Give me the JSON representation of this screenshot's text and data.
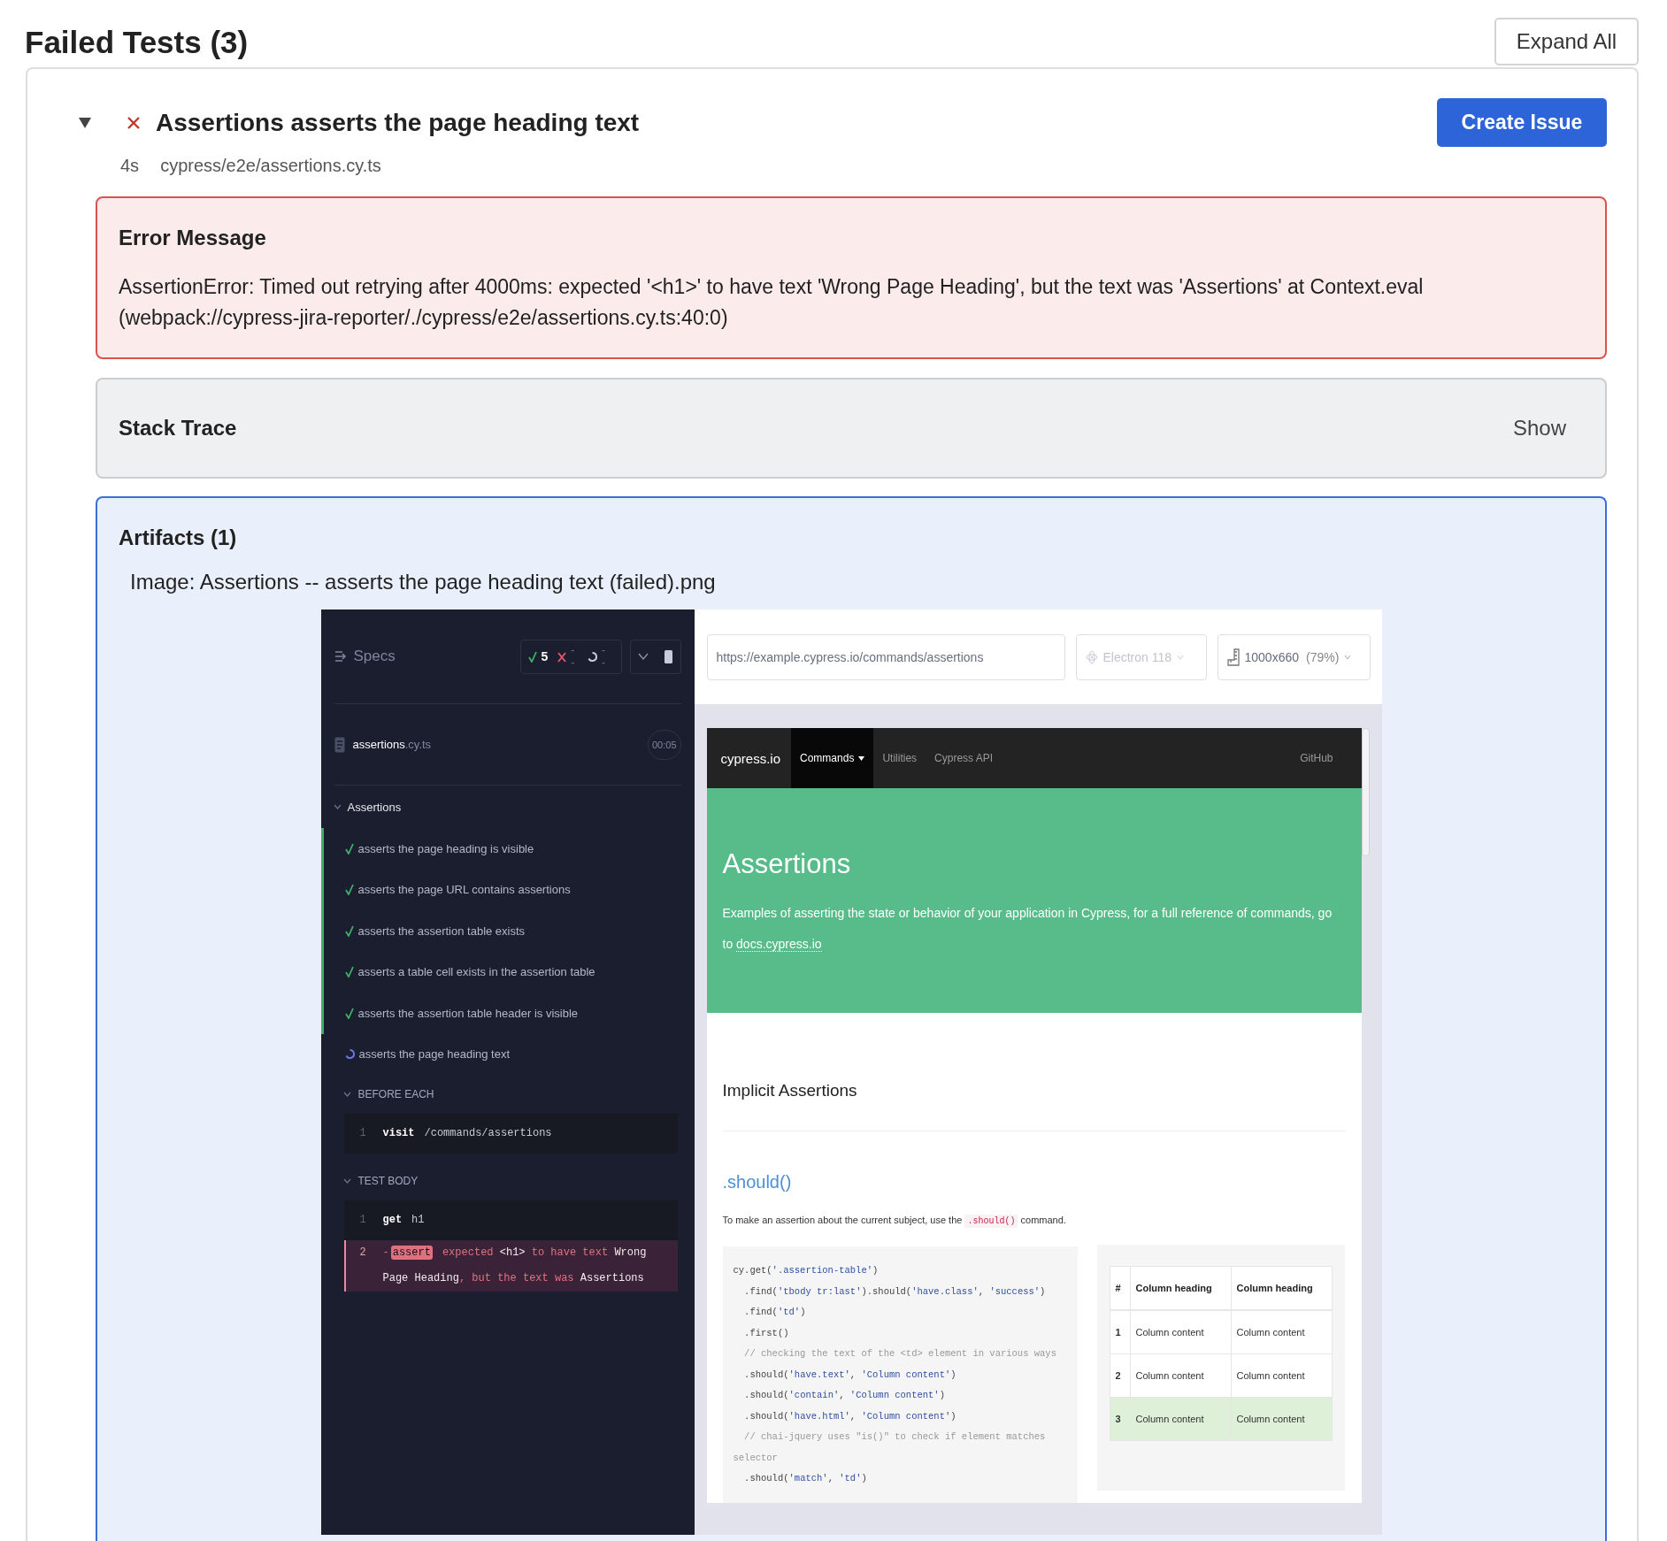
{
  "title": "Failed Tests (3)",
  "expand_all": "Expand All",
  "tests": [
    {
      "title": "Assertions asserts the page heading text",
      "kind": "failed",
      "expanded": true,
      "duration": "4s",
      "file": "cypress/e2e/assertions.cy.ts",
      "create_issue": "Create Issue",
      "error": {
        "title": "Error Message",
        "message": "AssertionError: Timed out retrying after 4000ms: expected '<h1>' to have text 'Wrong Page Heading', but the text was 'Assertions' at Context.eval (webpack://cypress-jira-reporter/./cypress/e2e/assertions.cy.ts:40:0)"
      },
      "stack_trace": {
        "title": "Stack Trace",
        "toggle": "Show"
      },
      "artifacts": {
        "title": "Artifacts (1)",
        "items": [
          {
            "kind": "image",
            "caption": "Image: Assertions -- asserts the page heading text (failed).png",
            "screenshot": {
              "runner": {
                "title": "Specs",
                "stats": [
                  {
                    "kind": "passed",
                    "count": "5"
                  },
                  {
                    "kind": "failed",
                    "count": "--"
                  },
                  {
                    "kind": "pending",
                    "count": "--"
                  }
                ],
                "spec": {
                  "name": "assertions",
                  "ext": ".cy.ts",
                  "time": "00:05"
                },
                "suite": {
                  "title": "Assertions",
                  "expanded": true,
                  "tests": [
                    {
                      "title": "asserts the page heading is visible",
                      "kind": "passed"
                    },
                    {
                      "title": "asserts the page URL contains assertions",
                      "kind": "passed"
                    },
                    {
                      "title": "asserts the assertion table exists",
                      "kind": "passed"
                    },
                    {
                      "title": "asserts a table cell exists in the assertion table",
                      "kind": "passed"
                    },
                    {
                      "title": "asserts the assertion table header is visible",
                      "kind": "passed"
                    },
                    {
                      "title": "asserts the page heading text",
                      "kind": "running"
                    }
                  ]
                },
                "sections": [
                  {
                    "title": "BEFORE EACH",
                    "expanded": true,
                    "commands": [
                      {
                        "number": "1",
                        "name": "visit",
                        "message": "/commands/assertions",
                        "kind": "passed"
                      }
                    ]
                  },
                  {
                    "title": "TEST BODY",
                    "expanded": true,
                    "commands": [
                      {
                        "number": "1",
                        "name": "get",
                        "message": "h1",
                        "kind": "passed"
                      },
                      {
                        "number": "2",
                        "prefix": "-",
                        "name": "assert",
                        "message": "expected **<h1>** to have text **Wrong Page Heading**, but the text was **Assertions**",
                        "kind": "failed"
                      }
                    ]
                  }
                ]
              },
              "browser": {
                "url": "https://example.cypress.io/commands/assertions",
                "engine": "Electron 118",
                "viewport": "1000x660",
                "scale": "(79%)"
              },
              "app": {
                "brand": "cypress.io",
                "nav": [
                  {
                    "label": "Commands",
                    "selected": true,
                    "dropdown": true
                  },
                  {
                    "label": "Utilities",
                    "selected": false,
                    "dropdown": false
                  },
                  {
                    "label": "Cypress API",
                    "selected": false,
                    "dropdown": false
                  }
                ],
                "nav_right": "GitHub",
                "banner": {
                  "title": "Assertions",
                  "text": "Examples of asserting the state or behavior of your application in Cypress, for a full reference of commands, go to",
                  "link": "docs.cypress.io"
                },
                "section_title": "Implicit Assertions",
                "subsection_title": ".should()",
                "intro": {
                  "before": "To make an assertion about the current subject, use the",
                  "code": ".should()",
                  "after": "command."
                },
                "code": [
                  {
                    "kind": "code",
                    "text": "cy.get('.assertion-table')"
                  },
                  {
                    "kind": "code",
                    "text": "  .find('tbody tr:last').should('have.class', 'success')"
                  },
                  {
                    "kind": "code",
                    "text": "  .find('td')"
                  },
                  {
                    "kind": "code",
                    "text": "  .first()"
                  },
                  {
                    "kind": "comment",
                    "text": "  // checking the text of the <td> element in various ways"
                  },
                  {
                    "kind": "code",
                    "text": "  .should('have.text', 'Column content')"
                  },
                  {
                    "kind": "code",
                    "text": "  .should('contain', 'Column content')"
                  },
                  {
                    "kind": "code",
                    "text": "  .should('have.html', 'Column content')"
                  },
                  {
                    "kind": "comment",
                    "text": "  // chai-jquery uses \"is()\" to check if element matches selector"
                  },
                  {
                    "kind": "code",
                    "text": "  .should('match', 'td')"
                  }
                ],
                "table": {
                  "columns": [
                    "#",
                    "Column heading",
                    "Column heading"
                  ],
                  "rows": [
                    {
                      "success": false,
                      "cells": [
                        "1",
                        "Column content",
                        "Column content"
                      ]
                    },
                    {
                      "success": false,
                      "cells": [
                        "2",
                        "Column content",
                        "Column content"
                      ]
                    },
                    {
                      "success": true,
                      "cells": [
                        "3",
                        "Column content",
                        "Column content"
                      ]
                    }
                  ]
                }
              }
            }
          }
        ]
      }
    }
  ]
}
